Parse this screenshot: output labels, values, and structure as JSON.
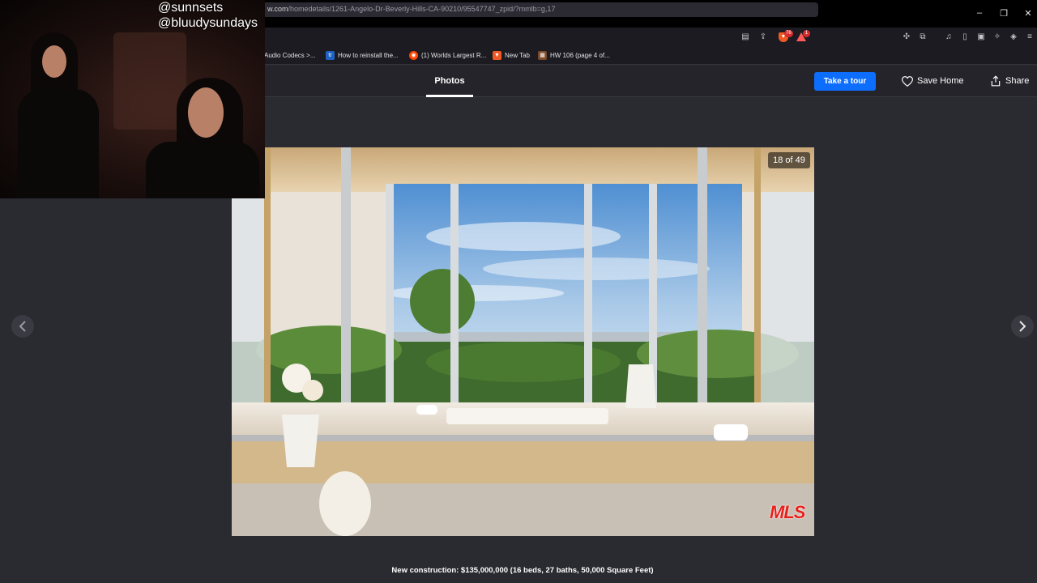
{
  "stream": {
    "handle_1": "@sunnsets",
    "handle_2": "@bluudysundays"
  },
  "browser": {
    "new_tab_glyph": "+",
    "url_host": "w.com",
    "url_path": "/homedetails/1261-Angelo-Dr-Beverly-Hills-CA-90210/95547747_zpid/?mmlb=g,17",
    "shields_count": "76",
    "rewards_badge": "1",
    "window_controls": [
      "–",
      "❐",
      "✕"
    ],
    "bookmarks": [
      {
        "label": "Audio Codecs >...",
        "icon": "audio-codecs-icon"
      },
      {
        "label": "How to reinstall the...",
        "icon": "tr-icon",
        "glyph": "tr",
        "color": "#1e63c2"
      },
      {
        "label": "(1) Worlds Largest R...",
        "icon": "reddit-icon",
        "glyph": "◉",
        "color": "#ff4500"
      },
      {
        "label": "New Tab",
        "icon": "brave-icon",
        "glyph": "▼",
        "color": "#f05a24"
      },
      {
        "label": "HW 106 (page 4 of...",
        "icon": "document-icon",
        "glyph": "▦",
        "color": "#7a4a2a"
      }
    ]
  },
  "page": {
    "tab_label": "Photos",
    "tour_button": "Take a tour",
    "save_label": "Save Home",
    "share_label": "Share",
    "accent_color": "#0d6efd"
  },
  "gallery": {
    "counter": "18 of 49",
    "logo": "THE MLS .com",
    "prev_icon": "chevron-left-icon",
    "next_icon": "chevron-right-icon",
    "caption": "New construction: $135,000,000 (16 beds, 27 baths, 50,000 Square Feet)"
  }
}
